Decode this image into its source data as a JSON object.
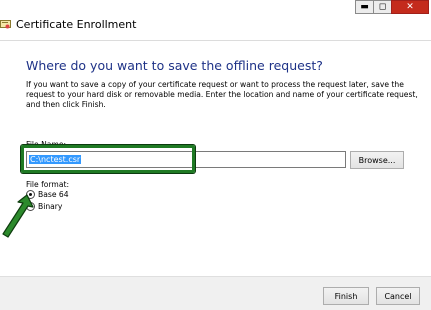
{
  "window": {
    "title": "Certificate Enrollment",
    "controls": {
      "minimize": "▬",
      "maximize": "◻",
      "close": "✕"
    }
  },
  "main": {
    "heading": "Where do you want to save the offline request?",
    "description": "If you want to save a copy of your certificate request or want to process the request later, save the request to your hard disk or removable media. Enter the location and name of your certificate request, and then click Finish.",
    "file_name": {
      "label": "File Name:",
      "value": "C:\\nctest.csr",
      "browse_label": "Browse..."
    },
    "file_format": {
      "label": "File format:",
      "options": [
        {
          "label": "Base 64",
          "checked": true
        },
        {
          "label": "Binary",
          "checked": false
        }
      ]
    }
  },
  "footer": {
    "finish_label": "Finish",
    "cancel_label": "Cancel"
  },
  "colors": {
    "heading": "#1e3287",
    "highlight": "#1f7a24",
    "arrow": "#2c8a2c",
    "close_button": "#c42b1c",
    "selection": "#3399ff"
  },
  "icons": {
    "app": "certificate-icon",
    "annotation": "green-arrow-icon"
  }
}
